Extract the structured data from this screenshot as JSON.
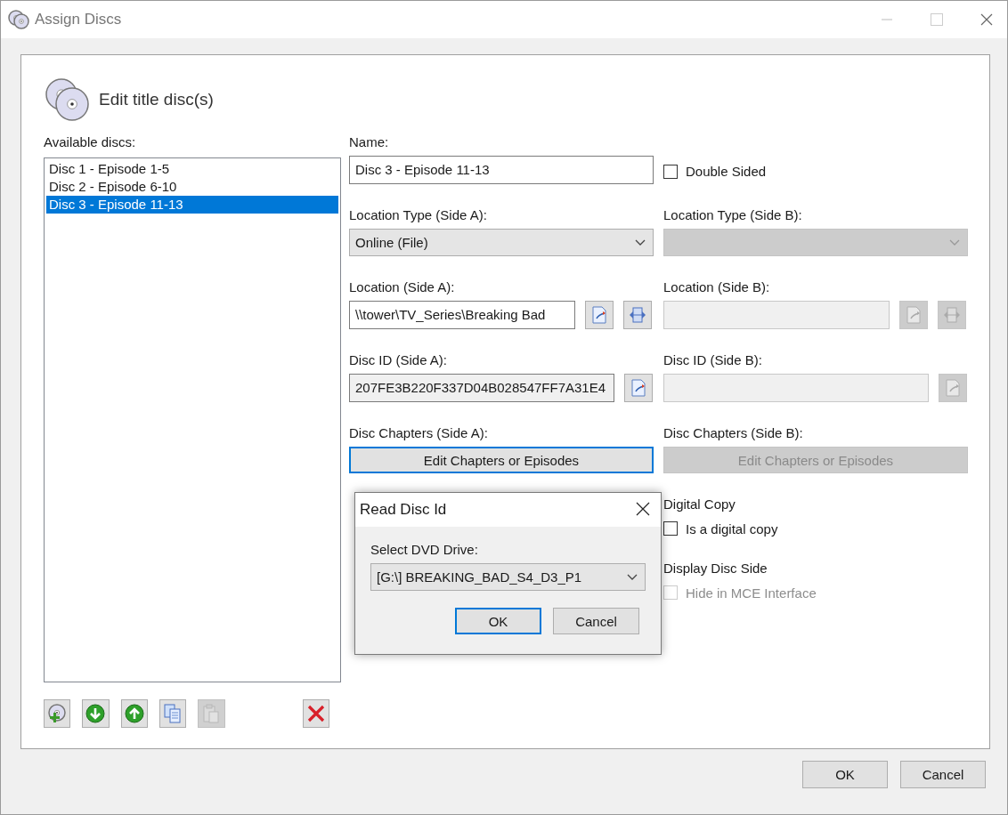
{
  "window": {
    "title": "Assign Discs"
  },
  "header": {
    "title": "Edit title disc(s)"
  },
  "discs": {
    "label": "Available discs:",
    "items": [
      {
        "label": "Disc 1 - Episode 1-5",
        "selected": false
      },
      {
        "label": "Disc 2 - Episode 6-10",
        "selected": false
      },
      {
        "label": "Disc 3 - Episode 11-13",
        "selected": true
      }
    ]
  },
  "toolbar": [
    {
      "kind": "add",
      "disabled": false
    },
    {
      "kind": "down",
      "disabled": false
    },
    {
      "kind": "up",
      "disabled": false
    },
    {
      "kind": "copy",
      "disabled": false
    },
    {
      "kind": "paste",
      "disabled": true
    },
    {
      "kind": "delete",
      "disabled": false
    }
  ],
  "name": {
    "label": "Name:",
    "value": "Disc 3 - Episode 11-13"
  },
  "double_sided": {
    "label": "Double Sided",
    "checked": false
  },
  "location_type": {
    "side_a": {
      "label": "Location Type (Side A):",
      "value": "Online (File)",
      "disabled": false
    },
    "side_b": {
      "label": "Location Type (Side B):",
      "disabled": true
    }
  },
  "location": {
    "side_a": {
      "label": "Location (Side A):",
      "value": "\\\\tower\\TV_Series\\Breaking Bad",
      "disabled": false
    },
    "side_b": {
      "label": "Location (Side B):",
      "disabled": true
    }
  },
  "disc_id": {
    "side_a": {
      "label": "Disc ID (Side A):",
      "value": "207FE3B220F337D04B028547FF7A31E4",
      "disabled": false
    },
    "side_b": {
      "label": "Disc ID (Side B):",
      "disabled": true
    }
  },
  "disc_chapters": {
    "side_a": {
      "label": "Disc Chapters (Side A):",
      "button": "Edit Chapters or Episodes",
      "disabled": false,
      "focused": true
    },
    "side_b": {
      "label": "Disc Chapters (Side B):",
      "button": "Edit Chapters or Episodes",
      "disabled": true
    }
  },
  "options": [
    {
      "label": "Digital Copy",
      "option": "Is a digital copy",
      "checked": false,
      "disabled": false
    },
    {
      "label": "Display Disc Side",
      "option": "Hide in MCE Interface",
      "checked": false,
      "disabled": true
    }
  ],
  "dialog": {
    "title": "Read Disc Id",
    "label": "Select DVD Drive:",
    "value": "[G:\\] BREAKING_BAD_S4_D3_P1",
    "buttons": [
      {
        "label": "OK",
        "default": true
      },
      {
        "label": "Cancel",
        "default": false
      }
    ]
  },
  "buttons": [
    {
      "label": "OK"
    },
    {
      "label": "Cancel"
    }
  ]
}
